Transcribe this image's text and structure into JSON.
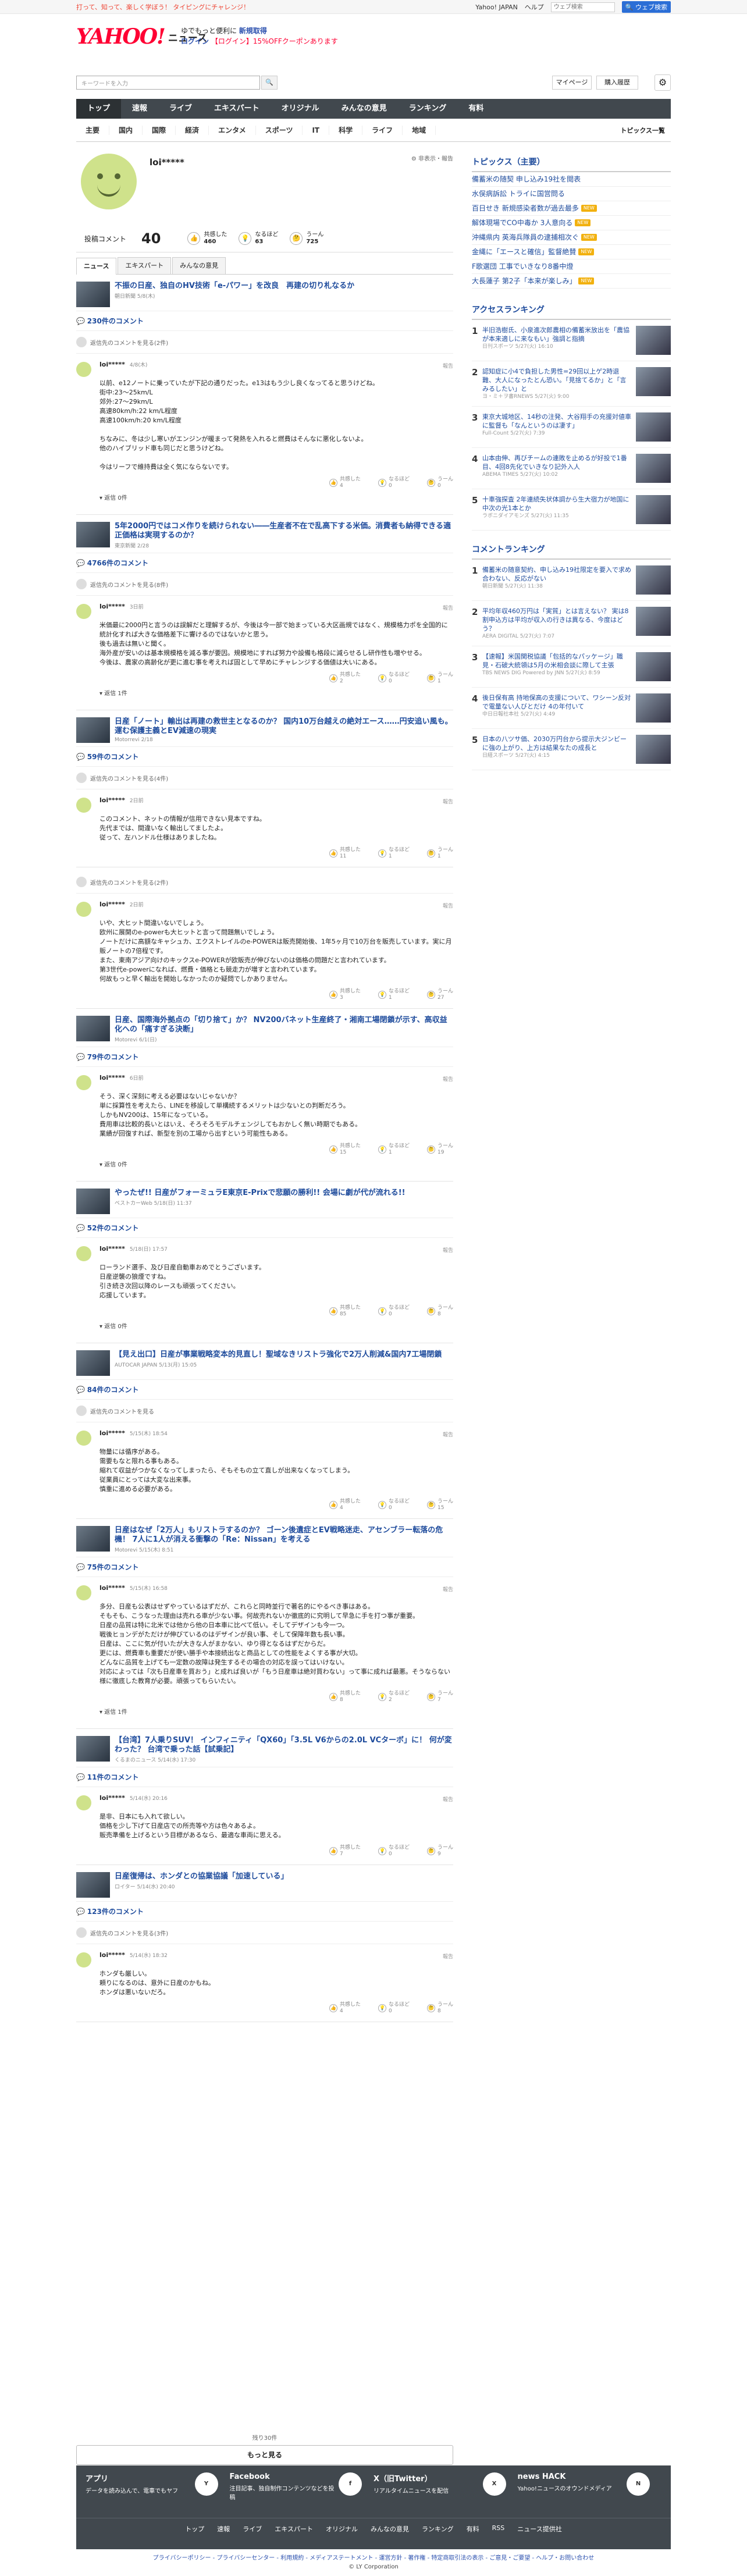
{
  "strip": {
    "tagline": "打って、知って、楽しく学ぼう！ タイピングにチャレンジ！",
    "links": [
      "Yahoo! JAPAN",
      "ヘルプ"
    ],
    "search_placeholder": "ウェブ検索",
    "search_btn": "🔍 ウェブ検索"
  },
  "header": {
    "logo": "YAHOO!",
    "logo_sub": "JAPAN",
    "news": "ニュース",
    "promo1": "ゆでもっと便利に",
    "promo1b": "新規取得",
    "promo2": "ログイン",
    "promo2b": "【ログイン】15%OFFクーポンあります",
    "search_placeholder": "キーワードを入力",
    "mypage": "マイページ",
    "buy": "購入履歴"
  },
  "nav": [
    "トップ",
    "速報",
    "ライブ",
    "エキスパート",
    "オリジナル",
    "みんなの意見",
    "ランキング",
    "有料"
  ],
  "subnav": [
    "主要",
    "国内",
    "国際",
    "経済",
    "エンタメ",
    "スポーツ",
    "IT",
    "科学",
    "ライフ",
    "地域"
  ],
  "subnav_all": "トピックス一覧",
  "profile": {
    "name": "loi*****",
    "edit": "⚙ 非表示・報告",
    "posted_label": "投稿コメント",
    "posted": "40",
    "r1_label": "共感した",
    "r1": "460",
    "r2_label": "なるほど",
    "r2": "63",
    "r3_label": "うーん",
    "r3": "725"
  },
  "tabs": [
    "ニュース",
    "エキスパート",
    "みんなの意見"
  ],
  "cards": [
    {
      "title": "不振の日産、独自のHV技術「e-パワー」を改良　再建の切り札なるか",
      "src": "朝日新聞 5/8(木)",
      "count": "230件のコメント",
      "prev": "返信先のコメントを見る(2件)",
      "name": "loi*****",
      "time": "4/8(木)",
      "body": "以前、e12ノートに乗っていたが下記の通りだった。e13はもう少し良くなってると思うけどね。\n街中:23〜25km/L\n郊外:27〜29km/L\n高速80km/h:22 km/L程度\n高速100km/h:20 km/L程度\n\nちなみに、冬は少し寒いがエンジンが暖まって発熱を入れると燃費はそんなに悪化しないよ。\n他のハイブリッド車も同じだと思うけどね。\n\n今はリーフで維持費は全く気にならないです。",
      "a": "4",
      "b": "0",
      "c": "0",
      "reply": "返信 0件"
    },
    {
      "title": "5年2000円ではコメ作りを続けられない――生産者不在で乱高下する米価。消費者も納得できる適正価格は実現するのか？",
      "src": "東京新聞 2/28",
      "count": "4766件のコメント",
      "prev": "返信先のコメントを見る(8件)",
      "name": "loi*****",
      "time": "3日前",
      "body": "米価最に2000円と言うのは誤解だと理解するが、今後は今一部で始まっている大区画規ではなく、規模格力ポを全国的に統計化すれば大きな価格差下に響けるのではないかと思う。\n後も過去は無いと聞く。\n海外産が安いのは基本規模格を減る事が要因。規模地にすれば努力や設備も格段に減らせるし研作性も増やせる。\n今後は、農家の高齢化が更に進む事を考えれば固として早めにチャレンジする価値は大いにある。",
      "a": "2",
      "b": "0",
      "c": "1",
      "reply": "返信 1件"
    },
    {
      "title": "日産「ノート」輸出は再建の救世主となるのか？ 国内10万台越えの絶対エース……円安追い風も。運む保護主義とEV減速の現実",
      "src": "Motorrevi 2/18",
      "count": "59件のコメント",
      "prev": "返信先のコメントを見る(4件)",
      "name": "loi*****",
      "time": "2日前",
      "body": "このコメント、ネットの情報が信用できない見本ですね。\n先代までは、間違いなく輸出してましたよ。\n従って、左ハンドル仕様はありましたね。",
      "a": "11",
      "b": "1",
      "c": "1",
      "reply": ""
    },
    {
      "title": "",
      "src": "",
      "count": "",
      "prev": "返信先のコメントを見る(2件)",
      "name": "loi*****",
      "time": "2日前",
      "body": "いや、大ヒット間違いないでしょう。\n欧州に展開のe-powerも大ヒットと言って問題無いでしょう。\nノートだけに高額なキャシュカ、エクストレイルのe-POWERは販売開始後、1年5ヶ月で10万台を販売しています。実に月販ノートの7倍程です。\nまた、東南アジア向けのキックスe-POWERが欧販売が伸びないのは価格の問題だと言われています。\n第3世代e-powerになれば、燃費・価格とも競走力が増すと言われています。\n何故もっと早く輸出を開始しなかったのか疑問でしかありません。",
      "a": "3",
      "b": "1",
      "c": "27",
      "reply": ""
    },
    {
      "title": "日産、国際海外拠点の「切り捨て」か？ NV200バネット生産終了・湘南工場閉鎖が示す、高収益化への「痛すぎる決断」",
      "src": "Motorevi 6/1(日)",
      "count": "79件のコメント",
      "prev": "",
      "name": "loi*****",
      "time": "6日前",
      "body": "そう、深く深刻に考える必要はないじゃないか？\n単に採算性を考えたら、LINEを移設して単構続するメリットは少ないとの判断だろう。\nしかもNV200は、15年になっている。\n費用車は比較的長いとはいえ、そろそろモデルチェンジしてもおかしく無い時期でもある。\n業績が回復すれば、新型を別の工場から出すという可能性もある。",
      "a": "15",
      "b": "1",
      "c": "19",
      "reply": "返信 0件"
    },
    {
      "title": "やったぜ!! 日産がフォーミュラE東京E-Prixで悲願の勝利!! 会場に劇が代が流れる!!",
      "src": "ベストカーWeb 5/18(日) 11:37",
      "count": "52件のコメント",
      "prev": "",
      "name": "loi*****",
      "time": "5/18(日) 17:57",
      "body": "ローランド選手、及び日産自動車おめでとうございます。\n日産逆襲の狼煙ですね。\n引き続き次回以降のレースも頑張ってください。\n応援しています。",
      "a": "85",
      "b": "0",
      "c": "8",
      "reply": "返信 0件"
    },
    {
      "title": "【見え出口】日産が事業戦略変本的見直し！聖域なきリストラ強化で2万人削減&国内7工場閉鎖",
      "src": "AUTOCAR JAPAN 5/13(月) 15:05",
      "count": "84件のコメント",
      "prev": "返信先のコメントを見る",
      "name": "loi*****",
      "time": "5/15(木) 18:54",
      "body": "物量には循序がある。\n需要もなと限れる事もある。\n縮れて収益がつかなくなってしまったら、そもそもの立て直しが出来なくなってしまう。\n従業員にとっては大変な出来事。\n慎重に進める必要がある。",
      "a": "4",
      "b": "0",
      "c": "15",
      "reply": ""
    },
    {
      "title": "日産はなぜ「2万人」もリストラするのか？ ゴーン後遺症とEV戦略迷走、アセンブラー転落の危機！ 7人に1人が消える衝撃の「Re：Nissan」を考える",
      "src": "Motorevi 5/15(木) 8:51",
      "count": "75件のコメント",
      "prev": "",
      "name": "loi*****",
      "time": "5/15(木) 16:58",
      "body": "多分、日産も公表はせずやっているはずだが、これらと同時並行で著名的にやるべき事はある。\nそもそも、こうなった理由は売れる車が少ない事。何故売れないか徹底的に究明して早急に手を打つ事が重要。\n日産の品質は特に北米では他から他の日本車に比べて低い。そしてデザインも今一つ。\n戦後ヒョンデがただけが伸びているのはデザインが良い事、そして保障年数も長い事。\n日産は、ここに気が付いたが大きな人がまかない、ゆり得となるはずだからだ。\n更には、燃費車も重要だが使い勝手や本接続出なと商品としての性能をよくする事が大切。\nどんなに品質を上げても一定数の故障は発生するその場合の対応を誤ってはいけない。\n対応によっては「次も日産車を買おう」と成れば良いが「もう日産車は絶対買わない」って事に成れば最悪。そうならない様に徹底した教育が必要。頑張ってもらいたい。",
      "a": "8",
      "b": "2",
      "c": "7",
      "reply": "返信 1件"
    },
    {
      "title": "【台湾】7人乗りSUV！ インフィニティ「QX60」「3.5L V6からの2.0L VCターボ」に！ 何が変わった？ 台湾で乗った話【試乗記】",
      "src": "くるまのニュース 5/14(水) 17:30",
      "count": "11件のコメント",
      "prev": "",
      "name": "loi*****",
      "time": "5/14(水) 20:16",
      "body": "是非、日本にも入れて欲しい。\n価格を少し下げて日産店での所売等や方は色々あるよ。\n販売準備を上げるという目標があるなら、最適な車両に思える。",
      "a": "7",
      "b": "0",
      "c": "9",
      "reply": ""
    },
    {
      "title": "日産復帰は、ホンダとの協業協議「加速している」",
      "src": "ロイター 5/14(水) 20:40",
      "count": "123件のコメント",
      "prev": "返信先のコメントを見る(3件)",
      "name": "loi*****",
      "time": "5/14(水) 18:32",
      "body": "ホンダも厳しい。\n頼りになるのは、意外に日産のかもね。\nホンダは悪いないだろ。",
      "a": "4",
      "b": "0",
      "c": "8",
      "reply": ""
    }
  ],
  "more": {
    "cnt": "残り30件",
    "btn": "もっと見る"
  },
  "side": {
    "topics_h": "トピックス（主要）",
    "topics": [
      {
        "t": "備蓄米の随契 申し込み19社を閲表",
        "b": ""
      },
      {
        "t": "水俣病訴訟 トライに国営問る",
        "b": ""
      },
      {
        "t": "百日せき 新規感染者数が過去最多",
        "b": "NEW"
      },
      {
        "t": "解体現場でCO中毒か 3人意向る",
        "b": "NEW"
      },
      {
        "t": "沖縄県内 英海兵隊員の逮捕相次ぐ",
        "b": "NEW"
      },
      {
        "t": "金縄に「エースと確信」監督絶賛",
        "b": "NEW"
      },
      {
        "t": "F歌選団 工事でいきなり8番中燈",
        "b": ""
      },
      {
        "t": "大長蓮子 第2子「本来が楽しみ」",
        "b": "NEW"
      }
    ],
    "acc_h": "アクセスランキング",
    "acc": [
      {
        "t": "半旧浩樹氏、小泉進次郎農相の備蓄米放出を「農協が本来適しに来なもい」強調と指摘",
        "s": "日刊スポーツ 5/27(火) 16:10"
      },
      {
        "t": "認知症に小4で負担した男性=29回以上ゲ2時退難、大人になったとん恐い。「見捨てるか」と「言みるしたい」と",
        "s": "ヨ・ミ＋ヲ書RNEWS 5/27(火) 9:00"
      },
      {
        "t": "東京大城地区、14秒の注発、大谷翔手の充援対値車に監督も「なんというのは凄す」",
        "s": "Full-Count 5/27(火) 7:39"
      },
      {
        "t": "山本由伸、再びチームの連敗を止めるが好投で1番目、4回8先化でいきなり記外入人",
        "s": "ABEMA TIMES 5/27(火) 10:02"
      },
      {
        "t": "十車強探査 2年連続失状体調から生大宿力が地国に中次の光1本とか",
        "s": "ラボニダイアモンズ 5/27(火) 11:35"
      }
    ],
    "com_h": "コメントランキング",
    "com": [
      {
        "t": "備蓄米の随意契約、申し込み19社限定を要入で求め合わない、反応がない",
        "s": "朝日新聞 5/27(火) 11:38"
      },
      {
        "t": "平均年収460万円は「実質」とは言えない？ 実は8割申込方は平均が収入の行きは異なる、今度はどう？",
        "s": "AERA DIGITAL 5/27(火) 7:07"
      },
      {
        "t": "【速報】米国関税協議「包括的なパッケージ」職見・石破大統領は5月の米相会談に際して主張",
        "s": "TBS NEWS DIG Powered by JNN 5/27(火) 8:59"
      },
      {
        "t": "後日保有高 持地保高の支援について、ワシーン反対で電量ない人びとだけ 4の年付いて",
        "s": "中日日報社本社 5/27(火) 4:49"
      },
      {
        "t": "日本の八ツサ価、2030万円台から提示大ジンビーに強の上がり、上方は結果なたの成長と",
        "s": "日経スポーツ 5/27(火) 4:15"
      }
    ]
  },
  "footer": {
    "cols": [
      {
        "h": "アプリ",
        "d": "データを読み込んで、電車でもヤフ",
        "i": "Y"
      },
      {
        "h": "Facebook",
        "d": "注目記事、独自制作コンテンツなどを投稿",
        "i": "f"
      },
      {
        "h": "X（旧Twitter）",
        "d": "リアルタイムニュースを配信",
        "i": "X"
      },
      {
        "h": "news HACK",
        "d": "Yahoo!ニュースのオウンドメディア",
        "i": "N"
      }
    ],
    "nav": [
      "トップ",
      "速報",
      "ライブ",
      "エキスパート",
      "オリジナル",
      "みんなの意見",
      "ランキング",
      "有料",
      "RSS",
      "ニュース提供社"
    ],
    "links": "プライバシーポリシー - プライバシーセンター - 利用規約 - メディアステートメント - 運営方針 - 著作権 - 特定商取引法の表示 - ご意見・ご要望 - ヘルプ・お問い合わせ",
    "copy": "© LY Corporation"
  }
}
